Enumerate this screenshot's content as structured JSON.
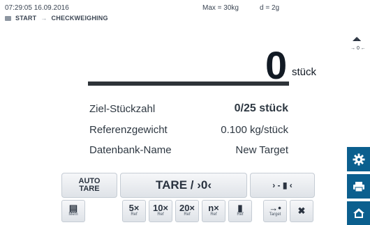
{
  "header": {
    "datetime": "07:29:05 16.09.2016",
    "max": "Max = 30kg",
    "d": "d = 2g"
  },
  "breadcrumb": {
    "start": "START",
    "arrow": "→",
    "current": "CHECKWEIGHING"
  },
  "status": {
    "level_symbol": "◢◣",
    "zero_indicator": "→ 0 ←"
  },
  "display": {
    "value": "0",
    "unit": "stück"
  },
  "info": [
    {
      "label": "Ziel-Stückzahl",
      "value": "0/25 stück"
    },
    {
      "label": "Referenzgewicht",
      "value": "0.100 kg/stück"
    },
    {
      "label": "Datenbank-Name",
      "value": "New Target"
    }
  ],
  "buttons": {
    "auto_tare_line1": "AUTO",
    "auto_tare_line2": "TARE",
    "tare_zero": "TARE / ›0‹",
    "target": "› - ▮ ‹"
  },
  "softkeys": [
    {
      "main": "▤",
      "sub": "Mem"
    },
    {
      "main": "5×",
      "sub": "Ref"
    },
    {
      "main": "10×",
      "sub": "Ref"
    },
    {
      "main": "20×",
      "sub": "Ref"
    },
    {
      "main": "n×",
      "sub": "Ref"
    },
    {
      "main": "▮",
      "sub": "Ref"
    },
    {
      "main": "→•",
      "sub": "Target"
    },
    {
      "main": "✖",
      "sub": ""
    }
  ],
  "colors": {
    "sidebar": "#0b5f8e",
    "text": "#2b3440"
  },
  "sidebar_icons": [
    "gear-icon",
    "printer-icon",
    "home-icon"
  ]
}
